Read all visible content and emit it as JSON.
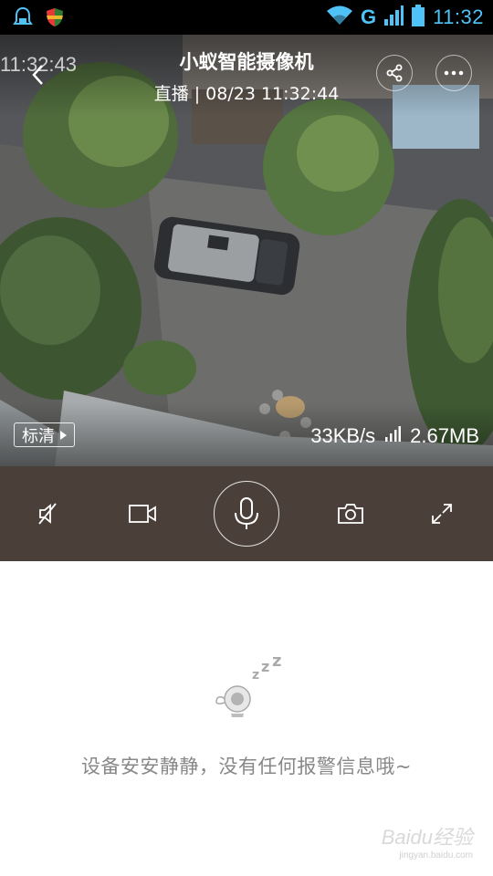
{
  "status_bar": {
    "time": "11:32",
    "network": "G",
    "icons": [
      "notification-icon",
      "shield-icon",
      "wifi-icon",
      "signal-icon",
      "battery-icon"
    ]
  },
  "player": {
    "title": "小蚁智能摄像机",
    "subtitle": "直播 | 08/23 11:32:44",
    "ghost_timestamp": "11:32:43",
    "quality_label": "标清",
    "bitrate": "33KB/s",
    "data_used": "2.67MB"
  },
  "controls": {
    "icons": [
      "mute-icon",
      "record-video-icon",
      "microphone-icon",
      "camera-icon",
      "fullscreen-icon"
    ]
  },
  "empty_state": {
    "message": "设备安安静静，没有任何报警信息哦~"
  },
  "watermark": {
    "brand": "Baidu经验",
    "url": "jingyan.baidu.com"
  },
  "colors": {
    "status_accent": "#4fc3f7",
    "control_bar": "#4a4039",
    "empty_text": "#888888"
  }
}
